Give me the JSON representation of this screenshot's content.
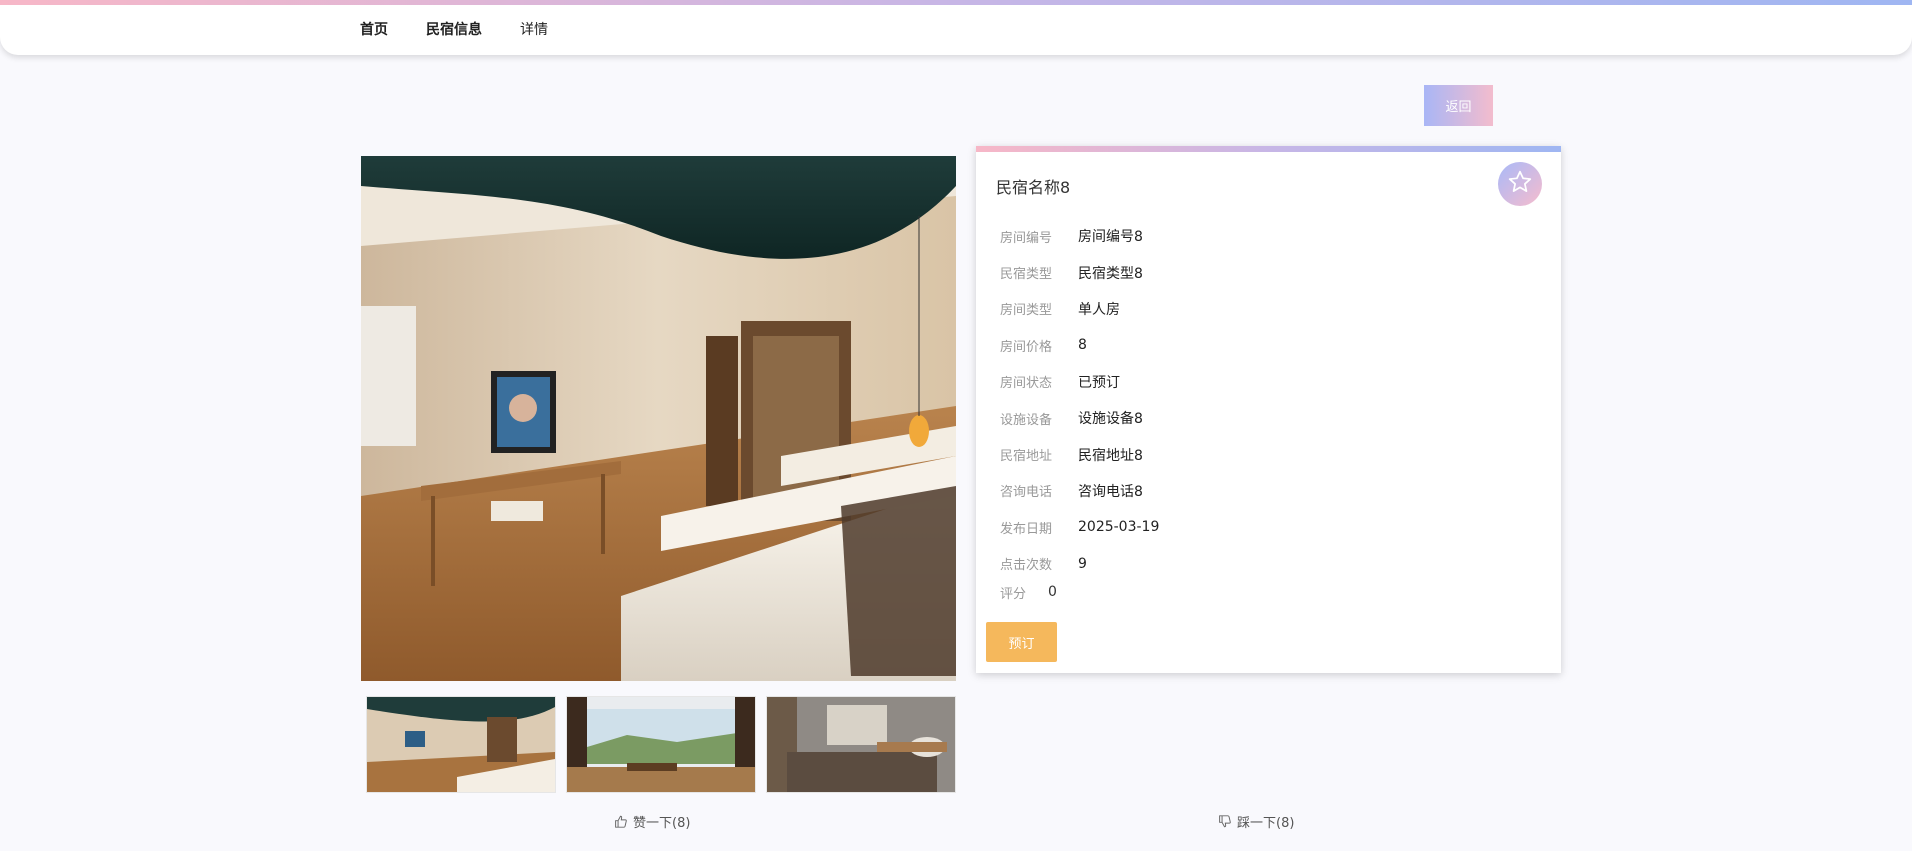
{
  "nav": {
    "items": [
      "首页",
      "民宿信息",
      "详情"
    ]
  },
  "back_label": "返回",
  "detail": {
    "title": "民宿名称8",
    "rows": [
      {
        "label": "房间编号",
        "value": "房间编号8"
      },
      {
        "label": "民宿类型",
        "value": "民宿类型8"
      },
      {
        "label": "房间类型",
        "value": "单人房"
      },
      {
        "label": "房间价格",
        "value": "8"
      },
      {
        "label": "房间状态",
        "value": "已预订"
      },
      {
        "label": "设施设备",
        "value": "设施设备8"
      },
      {
        "label": "民宿地址",
        "value": "民宿地址8"
      },
      {
        "label": "咨询电话",
        "value": "咨询电话8"
      },
      {
        "label": "发布日期",
        "value": "2025-03-19"
      },
      {
        "label": "点击次数",
        "value": "9"
      }
    ],
    "rating_label": "评分",
    "rating_value": "0",
    "book_label": "预订"
  },
  "votes": {
    "like": "赞一下(8)",
    "dislike": "踩一下(8)"
  },
  "icons": {
    "favorite": "star-icon",
    "like": "thumbs-up-icon",
    "dislike": "thumbs-down-icon"
  }
}
